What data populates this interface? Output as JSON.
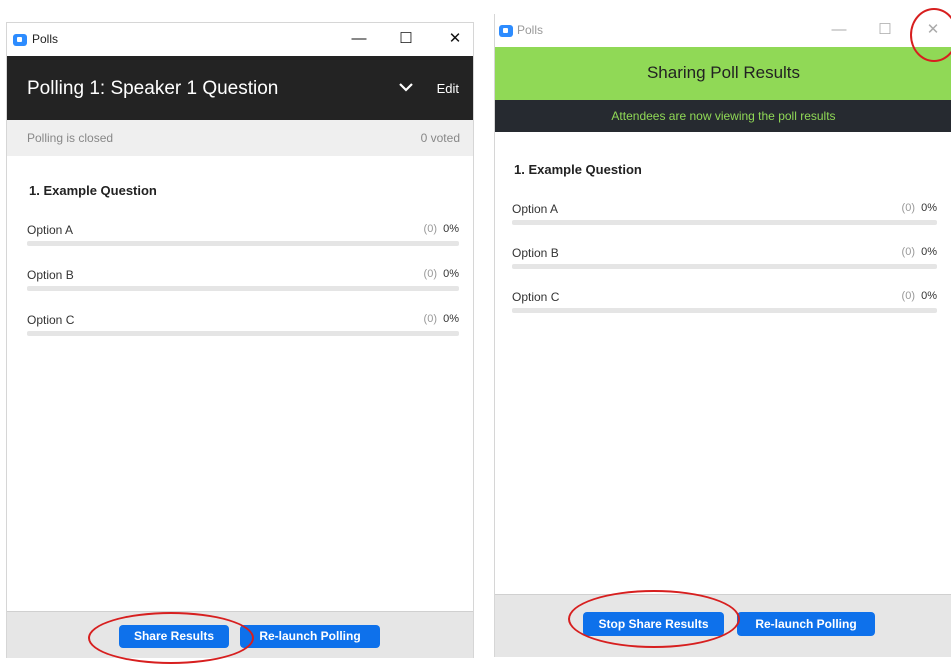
{
  "left_window": {
    "app_title": "Polls",
    "controls": [
      "—",
      "☐",
      "✕"
    ],
    "poll_title": "Polling 1: Speaker 1 Question",
    "edit_label": "Edit",
    "status": "Polling is closed",
    "voted": "0 voted",
    "question": "1. Example Question",
    "options": [
      {
        "label": "Option A",
        "count": "(0)",
        "percent": "0%",
        "value": 0
      },
      {
        "label": "Option B",
        "count": "(0)",
        "percent": "0%",
        "value": 0
      },
      {
        "label": "Option C",
        "count": "(0)",
        "percent": "0%",
        "value": 0
      }
    ],
    "share_button": "Share Results",
    "relaunch_button": "Re-launch Polling"
  },
  "right_window": {
    "app_title": "Polls",
    "controls": [
      "—",
      "☐",
      "✕"
    ],
    "header_title": "Sharing Poll Results",
    "notice": "Attendees are now viewing the poll results",
    "question": "1. Example Question",
    "options": [
      {
        "label": "Option A",
        "count": "(0)",
        "percent": "0%",
        "value": 0
      },
      {
        "label": "Option B",
        "count": "(0)",
        "percent": "0%",
        "value": 0
      },
      {
        "label": "Option C",
        "count": "(0)",
        "percent": "0%",
        "value": 0
      }
    ],
    "stop_share_button": "Stop Share Results",
    "relaunch_button": "Re-launch Polling"
  },
  "colors": {
    "brand_blue": "#0e71eb",
    "header_dark": "#232323",
    "share_green": "#90d956",
    "annotation_red": "#d71f1f"
  }
}
